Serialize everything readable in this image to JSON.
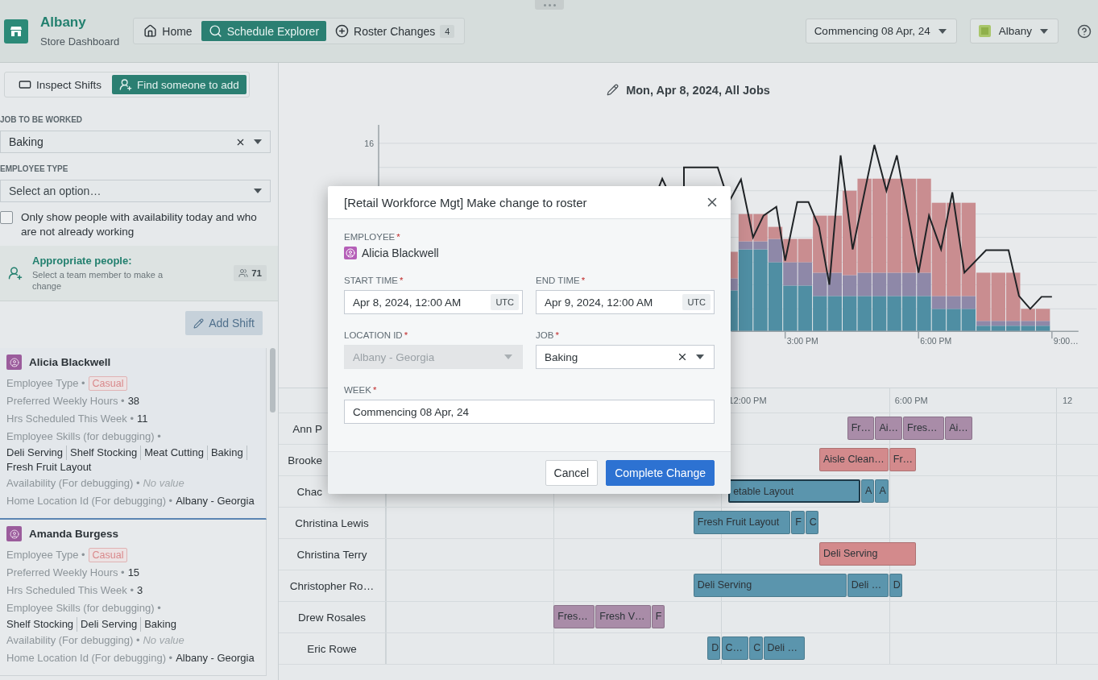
{
  "header": {
    "title": "Albany",
    "subtitle": "Store Dashboard",
    "nav": [
      {
        "label": "Home",
        "selected": false
      },
      {
        "label": "Schedule Explorer",
        "selected": true
      },
      {
        "label": "Roster Changes",
        "selected": false,
        "badge": "4"
      }
    ],
    "week_select": "Commencing 08 Apr, 24",
    "store_select": "Albany"
  },
  "sidebar": {
    "modes": [
      {
        "label": "Inspect Shifts",
        "selected": false
      },
      {
        "label": "Find someone to add",
        "selected": true
      }
    ],
    "job": {
      "label": "JOB TO BE WORKED",
      "value": "Baking"
    },
    "employee_type": {
      "label": "EMPLOYEE TYPE",
      "placeholder": "Select an option…"
    },
    "availability_filter": {
      "label": "Only show people with availability today and who are not already working",
      "checked": false
    },
    "results": {
      "title": "Appropriate people:",
      "hint": "Select a team member to make a change",
      "count": "71"
    },
    "add_shift": "Add Shift",
    "employees": [
      {
        "name": "Alicia Blackwell",
        "selected": true,
        "fields": [
          {
            "label": "Employee Type •",
            "kind": "tag",
            "value": "Casual"
          },
          {
            "label": "Preferred Weekly Hours •",
            "kind": "text",
            "value": "38"
          },
          {
            "label": "Hrs Scheduled This Week •",
            "kind": "text",
            "value": "11"
          },
          {
            "label": "Employee Skills (for debugging) •",
            "kind": "list",
            "values": [
              "Deli Serving",
              "Shelf Stocking",
              "Meat Cutting",
              "Baking",
              "Fresh Fruit Layout"
            ]
          },
          {
            "label": "Availability (For debugging) •",
            "kind": "empty",
            "value": "No value"
          },
          {
            "label": "Home Location Id (For debugging) •",
            "kind": "text",
            "value": "Albany - Georgia"
          }
        ]
      },
      {
        "name": "Amanda Burgess",
        "selected": false,
        "fields": [
          {
            "label": "Employee Type •",
            "kind": "tag",
            "value": "Casual"
          },
          {
            "label": "Preferred Weekly Hours •",
            "kind": "text",
            "value": "15"
          },
          {
            "label": "Hrs Scheduled This Week •",
            "kind": "text",
            "value": "3"
          },
          {
            "label": "Employee Skills (for debugging) •",
            "kind": "list",
            "values": [
              "Shelf Stocking",
              "Deli Serving",
              "Baking"
            ]
          },
          {
            "label": "Availability (For debugging) •",
            "kind": "empty",
            "value": "No value"
          },
          {
            "label": "Home Location Id (For debugging) •",
            "kind": "text",
            "value": "Albany - Georgia"
          }
        ]
      }
    ]
  },
  "chart": {
    "title": "Mon, Apr 8, 2024, All Jobs",
    "y_ticks": [
      "16"
    ],
    "x_ticks": [
      "3:00 PM",
      "6:00 PM",
      "9:00…"
    ]
  },
  "timeline": {
    "hours": [
      "12:00 PM",
      "6:00 PM",
      "12"
    ],
    "rows": [
      {
        "name": "Ann P",
        "clipped": true,
        "shifts": [
          {
            "label": "Fr…",
            "color": "#a98ca8",
            "selected": false
          },
          {
            "label": "Ai…",
            "color": "#a98ca8",
            "selected": false
          },
          {
            "label": "Fres…",
            "color": "#a98ca8",
            "selected": false
          },
          {
            "label": "Ai…",
            "color": "#a98ca8",
            "selected": false
          }
        ]
      },
      {
        "name": "Brooke",
        "clipped": true,
        "shifts": [
          {
            "label": "Aisle Clean…",
            "color": "#d38a8c",
            "selected": false
          },
          {
            "label": "Fr…",
            "color": "#d38a8c",
            "selected": false
          }
        ]
      },
      {
        "name": "Chac",
        "clipped": true,
        "shifts": [
          {
            "label": "etable Layout",
            "color": "#5b95ad",
            "selected": true
          },
          {
            "label": "A",
            "color": "#5b95ad",
            "selected": false
          },
          {
            "label": "A",
            "color": "#5b95ad",
            "selected": false
          }
        ]
      },
      {
        "name": "Christina Lewis",
        "clipped": false,
        "shifts": [
          {
            "label": "Fresh Fruit Layout",
            "color": "#5b95ad",
            "selected": false
          },
          {
            "label": "F",
            "color": "#5b95ad",
            "selected": false
          },
          {
            "label": "C",
            "color": "#5b95ad",
            "selected": false
          }
        ]
      },
      {
        "name": "Christina Terry",
        "clipped": false,
        "shifts": [
          {
            "label": "Deli Serving",
            "color": "#d38a8c",
            "selected": false
          }
        ]
      },
      {
        "name": "Christopher Ro…",
        "clipped": false,
        "shifts": [
          {
            "label": "Deli Serving",
            "color": "#5b95ad",
            "selected": false
          },
          {
            "label": "Deli …",
            "color": "#5b95ad",
            "selected": false
          },
          {
            "label": "D",
            "color": "#5b95ad",
            "selected": false
          }
        ]
      },
      {
        "name": "Drew Rosales",
        "clipped": false,
        "shifts": [
          {
            "label": "Fres…",
            "color": "#a98ca8",
            "selected": false
          },
          {
            "label": "Fresh V…",
            "color": "#a98ca8",
            "selected": false
          },
          {
            "label": "F",
            "color": "#a98ca8",
            "selected": false
          }
        ]
      },
      {
        "name": "Eric Rowe",
        "clipped": false,
        "shifts": [
          {
            "label": "D",
            "color": "#5b95ad",
            "selected": false
          },
          {
            "label": "C…",
            "color": "#5b95ad",
            "selected": false
          },
          {
            "label": "C",
            "color": "#5b95ad",
            "selected": false
          },
          {
            "label": "Deli …",
            "color": "#5b95ad",
            "selected": false
          }
        ]
      }
    ]
  },
  "dialog": {
    "title": "[Retail Workforce Mgt] Make change to roster",
    "fields": [
      {
        "label": "EMPLOYEE",
        "mark": "*",
        "kind": "person",
        "value": "Alicia Blackwell"
      },
      {
        "label": "START TIME",
        "mark": "*",
        "kind": "datetime",
        "value": "Apr 8, 2024, 12:00 AM",
        "zone": "UTC"
      },
      {
        "label": "END TIME",
        "mark": "*",
        "kind": "datetime",
        "value": "Apr 9, 2024, 12:00 AM",
        "zone": "UTC"
      },
      {
        "label": "LOCATION ID",
        "mark": "*",
        "kind": "select",
        "value": "Albany - Georgia",
        "disabled": true,
        "clearable": false
      },
      {
        "label": "JOB",
        "mark": "*",
        "kind": "select",
        "value": "Baking",
        "disabled": false,
        "clearable": true
      },
      {
        "label": "WEEK",
        "mark": "*",
        "kind": "text",
        "value": "Commencing 08 Apr, 24"
      }
    ],
    "buttons": [
      {
        "label": "Cancel",
        "primary": false
      },
      {
        "label": "Complete Change",
        "primary": true
      }
    ]
  }
}
